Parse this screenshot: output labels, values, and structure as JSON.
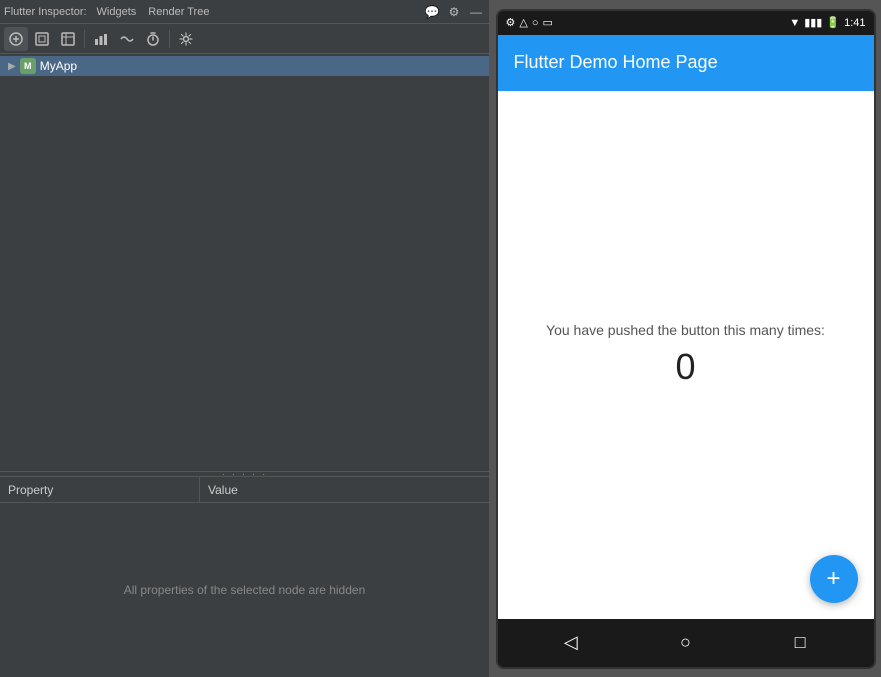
{
  "topbar": {
    "label": "Flutter Inspector:",
    "tabs": [
      "Widgets",
      "Render Tree"
    ],
    "icons": [
      "💬",
      "⚙",
      "—"
    ]
  },
  "toolbar": {
    "buttons": [
      {
        "name": "select-mode",
        "icon": "⊕",
        "title": "Select Mode"
      },
      {
        "name": "widget-mode",
        "icon": "▣",
        "title": "Widget Mode"
      },
      {
        "name": "render-mode",
        "icon": "⊡",
        "title": "Render Mode"
      },
      {
        "name": "performance",
        "icon": "▮▮▮",
        "title": "Performance"
      },
      {
        "name": "timeline",
        "icon": "∿",
        "title": "Timeline"
      },
      {
        "name": "timer",
        "icon": "⏱",
        "title": "Timer"
      },
      {
        "name": "settings",
        "icon": "⚙",
        "title": "Settings"
      }
    ]
  },
  "tree": {
    "items": [
      {
        "label": "MyApp",
        "expanded": false,
        "selected": true,
        "icon": "M",
        "depth": 0
      }
    ]
  },
  "properties": {
    "col_property": "Property",
    "col_value": "Value",
    "empty_message": "All properties of the selected node are hidden"
  },
  "phone": {
    "status_bar": {
      "left_icons": [
        "⚙",
        "△",
        "○",
        "□"
      ],
      "right_icons": [
        "▼",
        "📶",
        "🔋"
      ],
      "time": "1:41"
    },
    "app_bar_title": "Flutter Demo Home Page",
    "counter_text": "You have pushed the button this many times:",
    "counter_value": "0",
    "fab_icon": "+",
    "nav": {
      "back": "◁",
      "home": "○",
      "recent": "□"
    }
  },
  "colors": {
    "accent": "#2196F3",
    "selected_bg": "#4a6785",
    "panel_bg": "#3c3f41",
    "dark_bg": "#1a1a1a"
  }
}
